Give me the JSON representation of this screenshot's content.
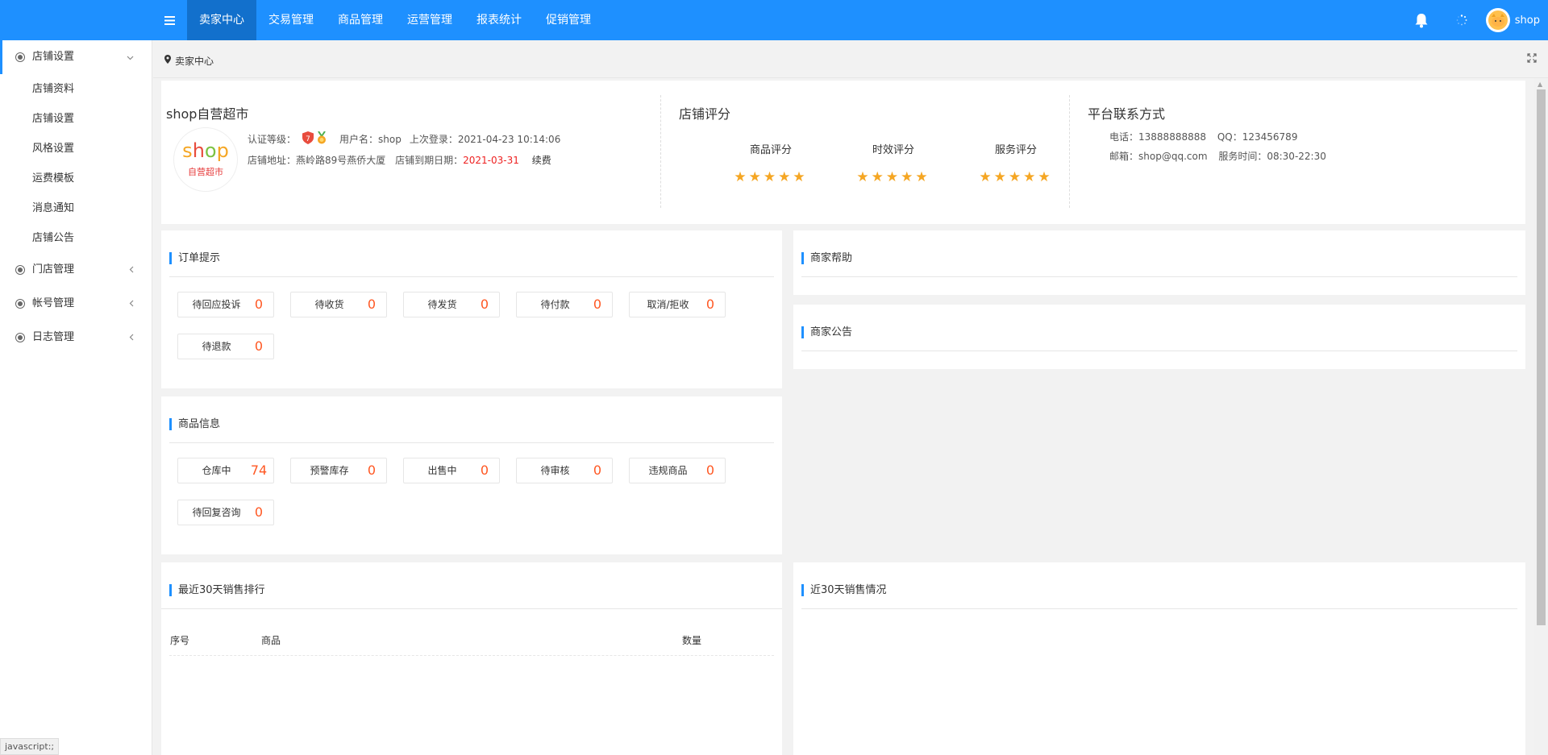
{
  "topbar": {
    "menu_icon": "menu-icon",
    "nav": [
      "卖家中心",
      "交易管理",
      "商品管理",
      "运营管理",
      "报表统计",
      "促销管理"
    ],
    "active_index": 0,
    "user_name": "shop",
    "brand_color": "#1e90ff"
  },
  "sidebar": {
    "groups": [
      {
        "label": "店铺设置",
        "expanded": true,
        "items": [
          "店铺资料",
          "店铺设置",
          "风格设置",
          "运费模板",
          "消息通知",
          "店铺公告"
        ]
      },
      {
        "label": "门店管理",
        "expanded": false
      },
      {
        "label": "帐号管理",
        "expanded": false
      },
      {
        "label": "日志管理",
        "expanded": false
      }
    ]
  },
  "breadcrumb": {
    "current": "卖家中心"
  },
  "shop": {
    "name": "shop自营超市",
    "logo_top": "shop",
    "logo_bottom": "自营超市",
    "cert_label": "认证等级：",
    "user_label": "用户名：",
    "user": "shop",
    "last_login_label": "上次登录：",
    "last_login": "2021-04-23 10:14:06",
    "address_label": "店铺地址：",
    "address": "燕岭路89号燕侨大厦",
    "expire_label": "店铺到期日期：",
    "expire_date": "2021-03-31",
    "renew": "续费"
  },
  "rating": {
    "title": "店铺评分",
    "items": [
      {
        "label": "商品评分",
        "stars": 5
      },
      {
        "label": "时效评分",
        "stars": 5
      },
      {
        "label": "服务评分",
        "stars": 5
      }
    ]
  },
  "contact": {
    "title": "平台联系方式",
    "phone_label": "电话：",
    "phone": "13888888888",
    "qq_label": "QQ：",
    "qq": "123456789",
    "email_label": "邮箱：",
    "email": "shop@qq.com",
    "hours_label": "服务时间：",
    "hours": "08:30-22:30"
  },
  "orders": {
    "title": "订单提示",
    "stats": [
      {
        "label": "待回应投诉",
        "value": "0"
      },
      {
        "label": "待收货",
        "value": "0"
      },
      {
        "label": "待发货",
        "value": "0"
      },
      {
        "label": "待付款",
        "value": "0"
      },
      {
        "label": "取消/拒收",
        "value": "0"
      },
      {
        "label": "待退款",
        "value": "0"
      }
    ]
  },
  "goods": {
    "title": "商品信息",
    "stats": [
      {
        "label": "仓库中",
        "value": "74"
      },
      {
        "label": "预警库存",
        "value": "0"
      },
      {
        "label": "出售中",
        "value": "0"
      },
      {
        "label": "待审核",
        "value": "0"
      },
      {
        "label": "违规商品",
        "value": "0"
      },
      {
        "label": "待回复咨询",
        "value": "0"
      }
    ]
  },
  "help": {
    "title": "商家帮助"
  },
  "notice": {
    "title": "商家公告"
  },
  "ranking": {
    "title": "最近30天销售排行",
    "columns": [
      "序号",
      "商品",
      "数量"
    ]
  },
  "sales": {
    "title": "近30天销售情况"
  },
  "status_url": "javascript:;"
}
